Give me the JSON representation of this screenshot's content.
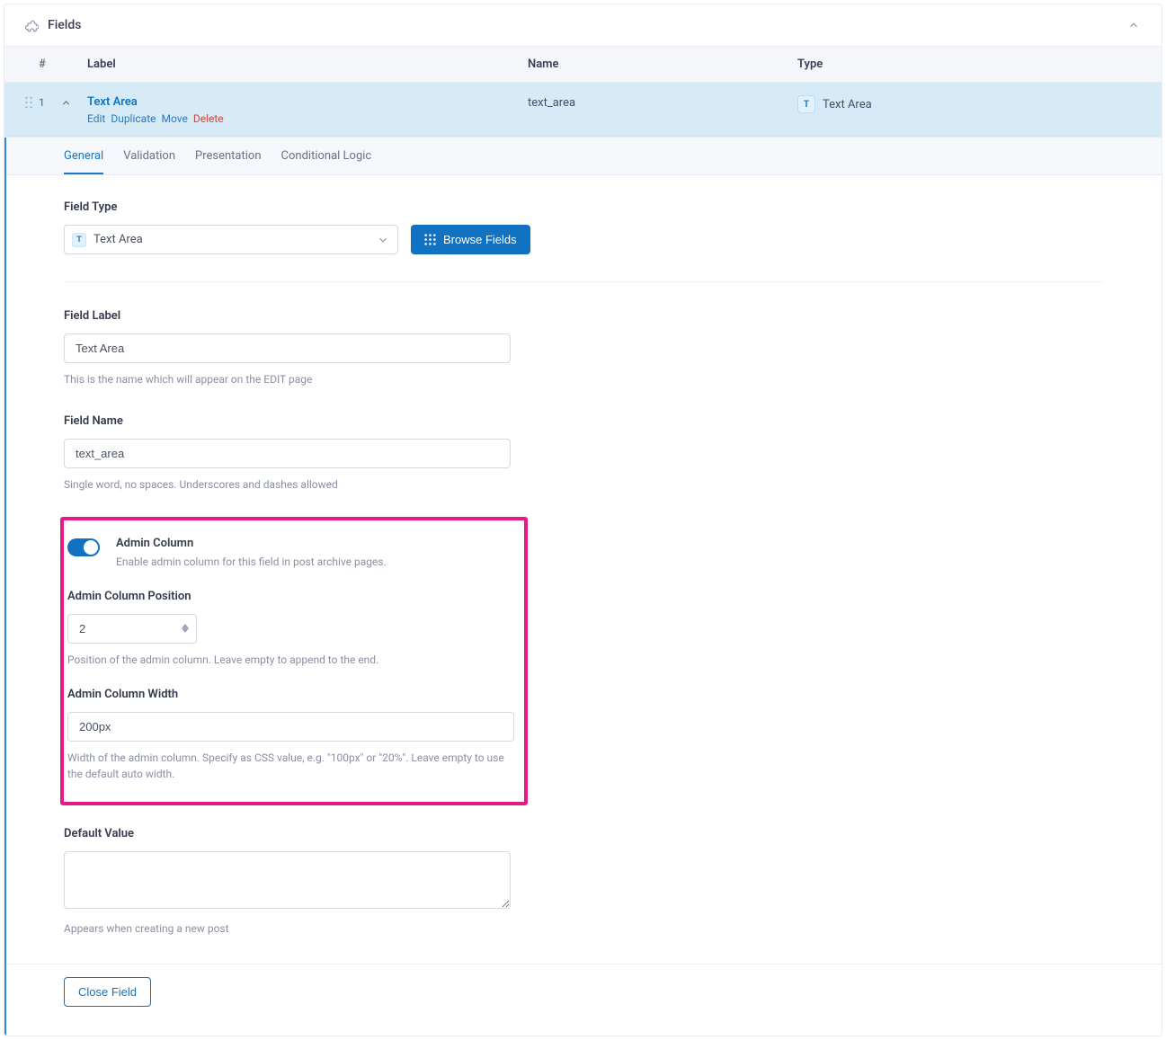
{
  "panel": {
    "title": "Fields"
  },
  "columns": {
    "index": "#",
    "label": "Label",
    "name": "Name",
    "type": "Type"
  },
  "row": {
    "index": "1",
    "label": "Text Area",
    "actions": {
      "edit": "Edit",
      "duplicate": "Duplicate",
      "move": "Move",
      "delete": "Delete"
    },
    "name": "text_area",
    "type": "Text Area",
    "type_badge": "T"
  },
  "tabs": [
    "General",
    "Validation",
    "Presentation",
    "Conditional Logic"
  ],
  "active_tab": 0,
  "fieldType": {
    "label": "Field Type",
    "value": "Text Area",
    "browse": "Browse Fields"
  },
  "fieldLabel": {
    "label": "Field Label",
    "value": "Text Area",
    "desc": "This is the name which will appear on the EDIT page"
  },
  "fieldName": {
    "label": "Field Name",
    "value": "text_area",
    "desc": "Single word, no spaces. Underscores and dashes allowed"
  },
  "adminColumn": {
    "label": "Admin Column",
    "desc": "Enable admin column for this field in post archive pages.",
    "enabled": true
  },
  "adminColumnPosition": {
    "label": "Admin Column Position",
    "value": "2",
    "desc": "Position of the admin column. Leave empty to append to the end."
  },
  "adminColumnWidth": {
    "label": "Admin Column Width",
    "value": "200px",
    "desc": "Width of the admin column. Specify as CSS value, e.g. \"100px\" or \"20%\". Leave empty to use the default auto width."
  },
  "defaultValue": {
    "label": "Default Value",
    "value": "",
    "desc": "Appears when creating a new post"
  },
  "closeField": "Close Field",
  "colors": {
    "accent": "#1172c2",
    "highlight": "#e71a84"
  }
}
